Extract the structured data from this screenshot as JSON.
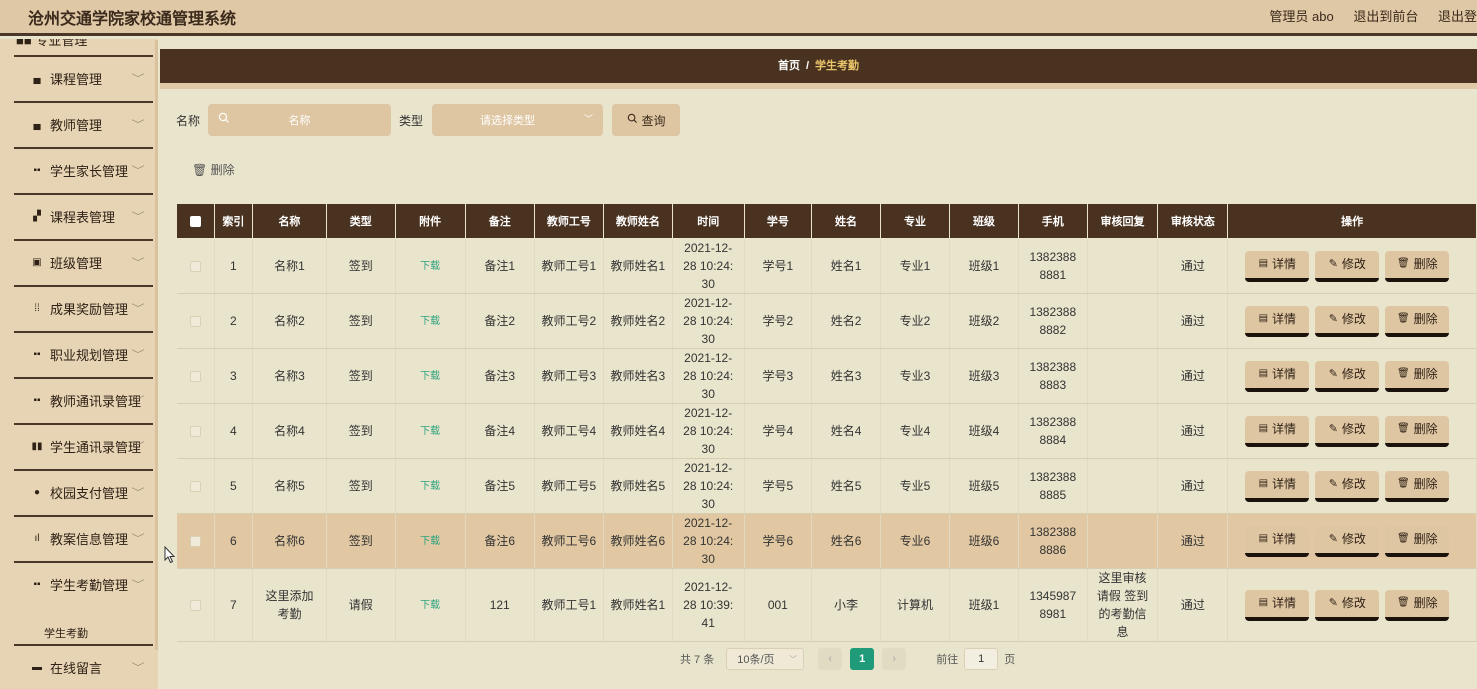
{
  "header": {
    "app_title": "沧州交通学院家校通管理系统",
    "admin_label": "管理员 abo",
    "back_to_front": "退出到前台",
    "logout": "退出登"
  },
  "sidebar": {
    "items": [
      {
        "icon": "document-icon",
        "label": "课程管理"
      },
      {
        "icon": "document-icon",
        "label": "教师管理"
      },
      {
        "icon": "grid-icon",
        "label": "学生家长管理"
      },
      {
        "icon": "thumb-icon",
        "label": "课程表管理"
      },
      {
        "icon": "calendar-icon",
        "label": "班级管理"
      },
      {
        "icon": "grid9-icon",
        "label": "成果奖励管理"
      },
      {
        "icon": "grid-icon",
        "label": "职业规划管理"
      },
      {
        "icon": "grid-icon",
        "label": "教师通讯录管理"
      },
      {
        "icon": "chart-icon",
        "label": "学生通讯录管理"
      },
      {
        "icon": "location-icon",
        "label": "校园支付管理"
      },
      {
        "icon": "bar-icon",
        "label": "教案信息管理"
      },
      {
        "icon": "grid-icon",
        "label": "学生考勤管理"
      },
      {
        "icon": "message-icon",
        "label": "在线留言"
      }
    ],
    "sub_item": "学生考勤"
  },
  "breadcrumb": {
    "home": "首页",
    "sep": "/",
    "current": "学生考勤"
  },
  "search": {
    "name_label": "名称",
    "name_placeholder": "名称",
    "type_label": "类型",
    "type_placeholder": "请选择类型",
    "query_label": "查询"
  },
  "toolbar": {
    "delete_label": "删除"
  },
  "table": {
    "columns": [
      "索引",
      "名称",
      "类型",
      "附件",
      "备注",
      "教师工号",
      "教师姓名",
      "时间",
      "学号",
      "姓名",
      "专业",
      "班级",
      "手机",
      "审核回复",
      "审核状态",
      "操作"
    ],
    "rows": [
      {
        "idx": "1",
        "name": "名称1",
        "type": "签到",
        "attach": "下载",
        "note": "备注1",
        "tno": "教师工号1",
        "tname": "教师姓名1",
        "time": "2021-12-28 10:24:30",
        "sno": "学号1",
        "sname": "姓名1",
        "major": "专业1",
        "class": "班级1",
        "phone": "13823888881",
        "reply": "",
        "status": "通过"
      },
      {
        "idx": "2",
        "name": "名称2",
        "type": "签到",
        "attach": "下载",
        "note": "备注2",
        "tno": "教师工号2",
        "tname": "教师姓名2",
        "time": "2021-12-28 10:24:30",
        "sno": "学号2",
        "sname": "姓名2",
        "major": "专业2",
        "class": "班级2",
        "phone": "13823888882",
        "reply": "",
        "status": "通过"
      },
      {
        "idx": "3",
        "name": "名称3",
        "type": "签到",
        "attach": "下载",
        "note": "备注3",
        "tno": "教师工号3",
        "tname": "教师姓名3",
        "time": "2021-12-28 10:24:30",
        "sno": "学号3",
        "sname": "姓名3",
        "major": "专业3",
        "class": "班级3",
        "phone": "13823888883",
        "reply": "",
        "status": "通过"
      },
      {
        "idx": "4",
        "name": "名称4",
        "type": "签到",
        "attach": "下载",
        "note": "备注4",
        "tno": "教师工号4",
        "tname": "教师姓名4",
        "time": "2021-12-28 10:24:30",
        "sno": "学号4",
        "sname": "姓名4",
        "major": "专业4",
        "class": "班级4",
        "phone": "13823888884",
        "reply": "",
        "status": "通过"
      },
      {
        "idx": "5",
        "name": "名称5",
        "type": "签到",
        "attach": "下载",
        "note": "备注5",
        "tno": "教师工号5",
        "tname": "教师姓名5",
        "time": "2021-12-28 10:24:30",
        "sno": "学号5",
        "sname": "姓名5",
        "major": "专业5",
        "class": "班级5",
        "phone": "13823888885",
        "reply": "",
        "status": "通过"
      },
      {
        "idx": "6",
        "name": "名称6",
        "type": "签到",
        "attach": "下载",
        "note": "备注6",
        "tno": "教师工号6",
        "tname": "教师姓名6",
        "time": "2021-12-28 10:24:30",
        "sno": "学号6",
        "sname": "姓名6",
        "major": "专业6",
        "class": "班级6",
        "phone": "13823888886",
        "reply": "",
        "status": "通过"
      },
      {
        "idx": "7",
        "name": "这里添加考勤",
        "type": "请假",
        "attach": "下载",
        "note": "121",
        "tno": "教师工号1",
        "tname": "教师姓名1",
        "time": "2021-12-28 10:39:41",
        "sno": "001",
        "sname": "小李",
        "major": "计算机",
        "class": "班级1",
        "phone": "13459878981",
        "reply": "这里审核请假 签到的考勤信息",
        "status": "通过"
      }
    ],
    "actions": {
      "detail": "详情",
      "edit": "修改",
      "delete": "删除"
    }
  },
  "pagination": {
    "total": "共 7 条",
    "page_size": "10条/页",
    "current_page": "1",
    "goto_label": "前往",
    "goto_value": "1",
    "page_unit": "页"
  },
  "colors": {
    "header_bg": "#dfc8a5",
    "dark_brown": "#4a3220",
    "accent_gold": "#e8c46a",
    "download_green": "#2aa37e",
    "page_green": "#1f9b7a"
  }
}
